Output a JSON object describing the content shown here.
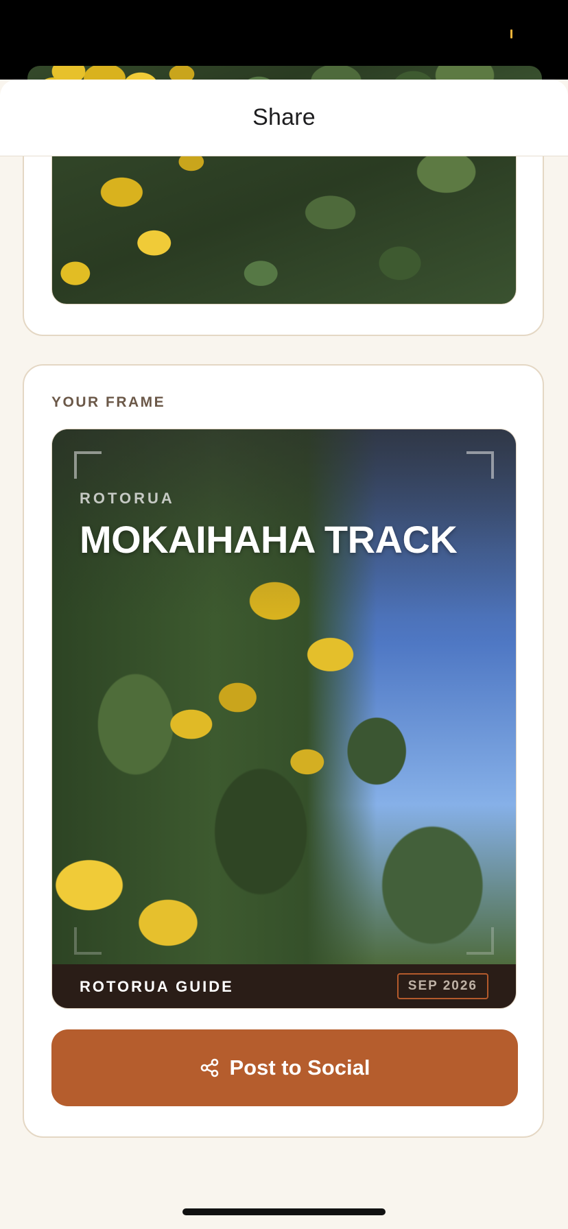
{
  "sheet": {
    "title": "Share"
  },
  "frame_card": {
    "label": "YOUR FRAME",
    "kicker": "ROTORUA",
    "title": "MOKAIHAHA TRACK",
    "brand": "ROTORUA GUIDE",
    "date": "SEP 2026"
  },
  "actions": {
    "post_label": "Post to Social",
    "post_icon": "share-icon"
  },
  "colors": {
    "accent": "#b55d2d",
    "background": "#f9f5ee",
    "card_border": "#e4d7c4",
    "footer": "#2a1d17"
  }
}
